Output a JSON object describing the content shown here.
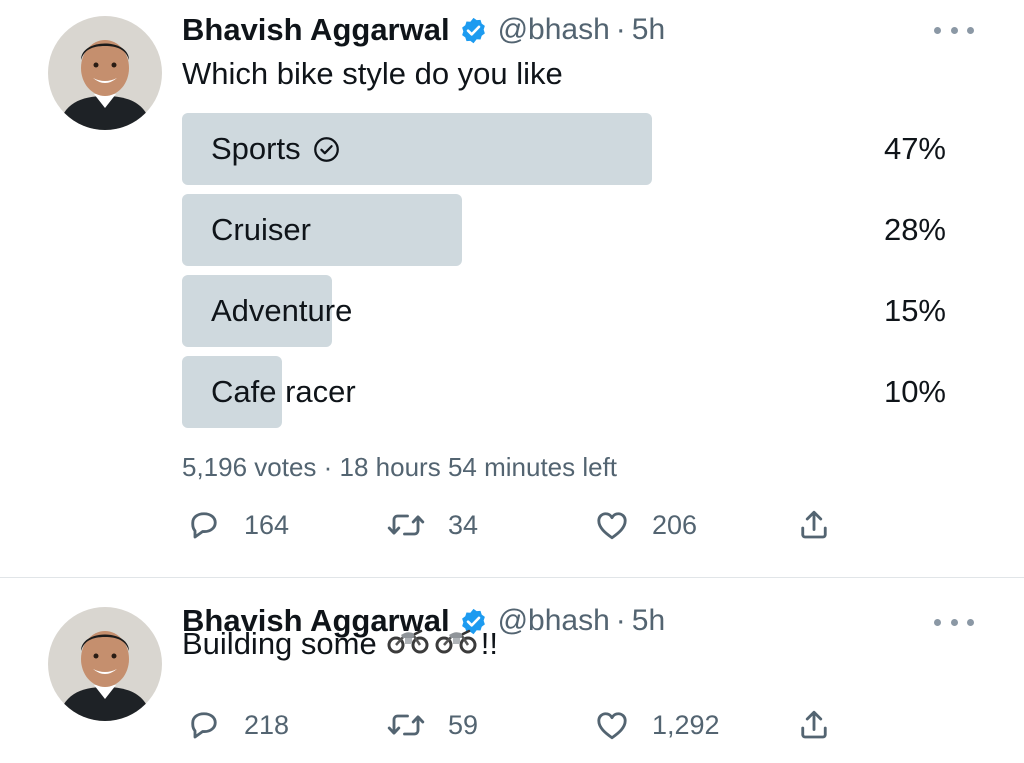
{
  "tweets": [
    {
      "author_name": "Bhavish Aggarwal",
      "handle": "@bhash",
      "separator": "·",
      "time": "5h",
      "text": "Which bike style do you like",
      "poll": {
        "options": [
          {
            "label": "Sports",
            "percent": "47%",
            "share": 0.47,
            "selected": true
          },
          {
            "label": "Cruiser",
            "percent": "28%",
            "share": 0.28
          },
          {
            "label": "Adventure",
            "percent": "15%",
            "share": 0.15
          },
          {
            "label": "Cafe racer",
            "percent": "10%",
            "share": 0.1
          }
        ],
        "meta": "5,196 votes · 18 hours 54 minutes left"
      },
      "replies": "164",
      "retweets": "34",
      "likes": "206"
    },
    {
      "author_name": "Bhavish Aggarwal",
      "handle": "@bhash",
      "separator": "·",
      "time": "5h",
      "text": "Building some",
      "text_suffix": "!!",
      "emoji": [
        "motorcycle-emoji",
        "motorcycle-emoji"
      ],
      "replies": "218",
      "retweets": "59",
      "likes": "1,292"
    }
  ],
  "colors": {
    "verified_blue": "#1d9bf0",
    "poll_fill": "#cfd9de",
    "secondary_text": "#536471"
  },
  "icons": [
    "verified-badge-icon",
    "more-icon",
    "check-circle-icon",
    "reply-icon",
    "retweet-icon",
    "like-icon",
    "share-icon"
  ]
}
